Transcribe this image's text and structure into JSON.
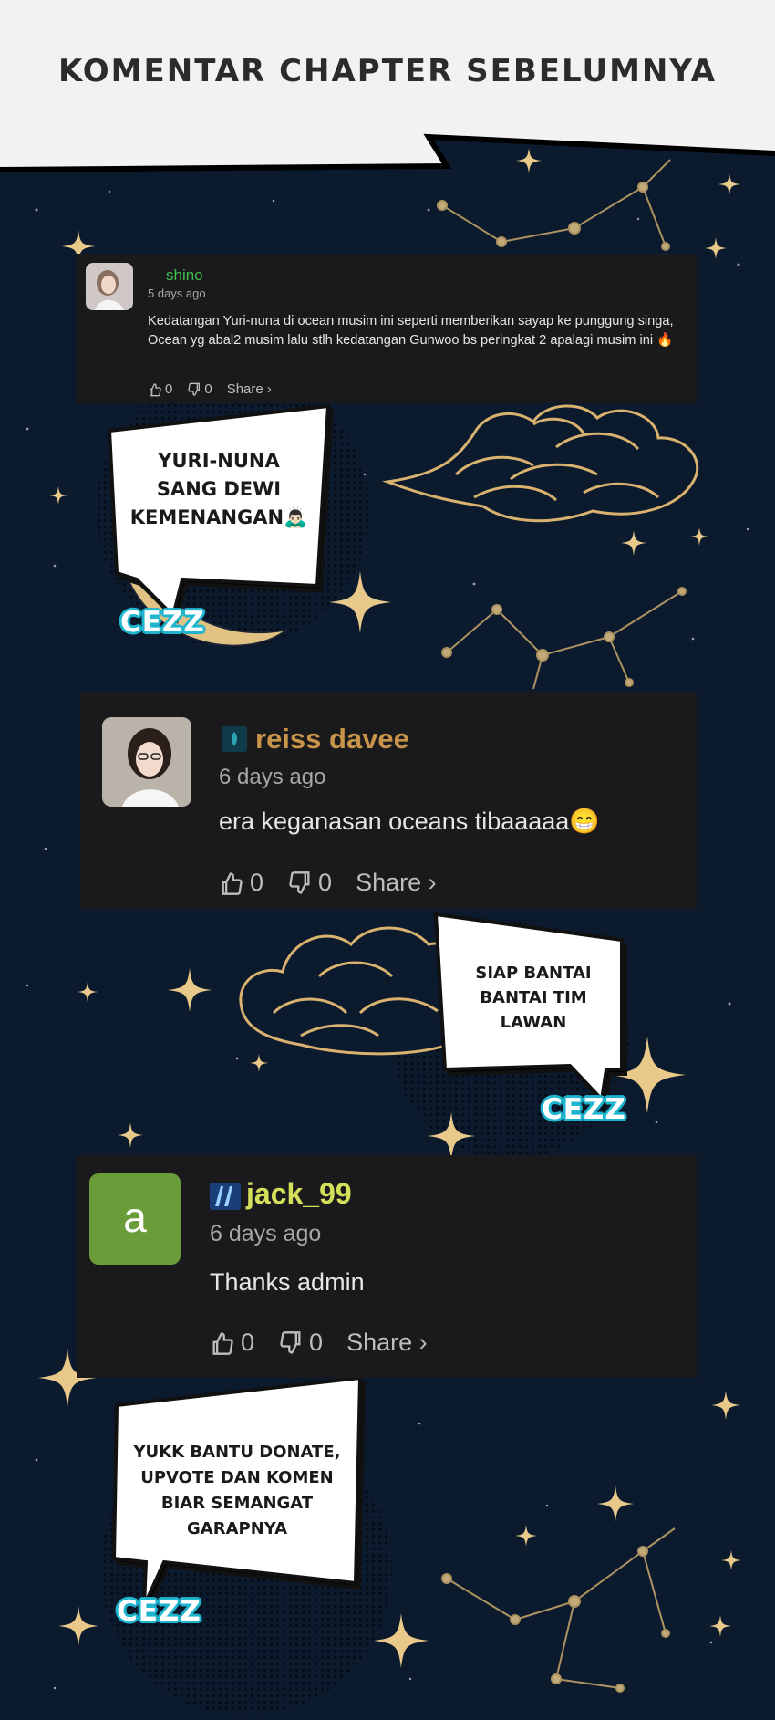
{
  "header": {
    "title": "KOMENTAR CHAPTER SEBELUMNYA"
  },
  "comments": [
    {
      "username": "shino",
      "date": "5 days ago",
      "text": "Kedatangan Yuri-nuna di ocean musim ini seperti memberikan sayap ke punggung singa, Ocean yg abal2 musim lalu stlh kedatangan Gunwoo bs peringkat 2 apalagi musim ini 🔥",
      "likes": "0",
      "dislikes": "0",
      "share_label": "Share ›",
      "username_color": "#3fbf4f"
    },
    {
      "username": "reiss davee",
      "date": "6 days ago",
      "text": "era keganasan oceans tibaaaaa😁",
      "likes": "0",
      "dislikes": "0",
      "share_label": "Share ›",
      "username_color": "#c8944a"
    },
    {
      "username": "jack_99",
      "date": "6 days ago",
      "text": "Thanks admin",
      "avatar_letter": "a",
      "likes": "0",
      "dislikes": "0",
      "share_label": "Share ›",
      "username_color": "#d5e05a"
    }
  ],
  "bubbles": [
    {
      "text": "YURi-NUNA SANG DEWi KEMENANGAN🙇🏻‍♂️"
    },
    {
      "text": "SiAP BANTAi BANTAi TiM LAWAN"
    },
    {
      "text": "YUKK BANTU DONATE, UPVOTE DAN KOMEN BiAR SEMANGAT GARAPNYA"
    }
  ],
  "watermark": "CEZZ",
  "colors": {
    "background": "#0c1a2e",
    "card": "#1a1a1c",
    "gold": "#d8b26e",
    "watermark": "#1fb5cf",
    "header": "#f2f2f2"
  }
}
